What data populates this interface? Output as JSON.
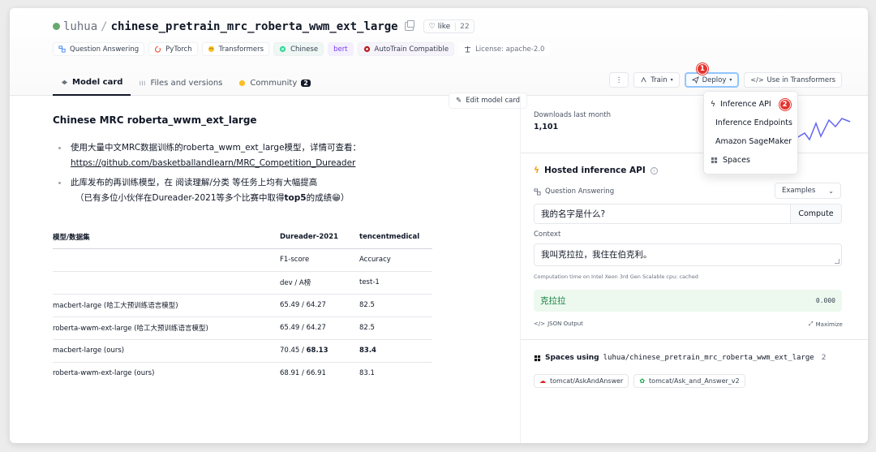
{
  "repo": {
    "owner": "luhua",
    "separator": "/",
    "name": "chinese_pretrain_mrc_roberta_wwm_ext_large",
    "like_label": "like",
    "like_count": "22"
  },
  "tags": [
    {
      "label": "Question Answering",
      "icon": "qa-icon"
    },
    {
      "label": "PyTorch",
      "icon": "pytorch-icon"
    },
    {
      "label": "Transformers",
      "icon": "hf-icon"
    },
    {
      "label": "Chinese",
      "icon": "globe-icon"
    },
    {
      "label": "bert",
      "icon": ""
    },
    {
      "label": "AutoTrain Compatible",
      "icon": "autotrain-icon"
    },
    {
      "label": "License: apache-2.0",
      "icon": "scale-icon"
    }
  ],
  "tabs": {
    "model_card": "Model card",
    "files": "Files and versions",
    "community": "Community",
    "community_count": "2"
  },
  "actions": {
    "more": "⋮",
    "train": "Train",
    "deploy": "Deploy",
    "use_in": "Use in Transformers"
  },
  "callouts": {
    "one": "1",
    "two": "2"
  },
  "deploy_menu": [
    {
      "label": "Inference API",
      "icon": "bolt-icon"
    },
    {
      "label": "Inference Endpoints",
      "icon": "endpoints-icon"
    },
    {
      "label": "Amazon SageMaker",
      "icon": "sagemaker-icon"
    },
    {
      "label": "Spaces",
      "icon": "spaces-icon"
    }
  ],
  "edit_card": "Edit model card",
  "model_card": {
    "heading": "Chinese MRC roberta_wwm_ext_large",
    "bullet1_line1": "使用大量中文MRC数据训练的roberta_wwm_ext_large模型，详情可查看：",
    "bullet1_link": "https://github.com/basketballandlearn/MRC_Competition_Dureader",
    "bullet2_line1": "此库发布的再训练模型，在 阅读理解/分类 等任务上均有大幅提高",
    "bullet2_line2_pre": "（已有多位小伙伴在Dureader-2021等多个比赛中取得",
    "bullet2_line2_bold": "top5",
    "bullet2_line2_post": "的成绩😁）"
  },
  "table": {
    "headers": [
      "模型/数据集",
      "Dureader-2021",
      "tencentmedical"
    ],
    "rows": [
      [
        "",
        "F1-score",
        "Accuracy"
      ],
      [
        "",
        "dev / A榜",
        "test-1"
      ],
      [
        "macbert-large (哈工大预训练语言模型)",
        "65.49 / 64.27",
        "82.5"
      ],
      [
        "roberta-wwm-ext-large (哈工大预训练语言模型)",
        "65.49 / 64.27",
        "82.5"
      ],
      [
        "macbert-large (ours)",
        "70.45 / ",
        "83.4"
      ],
      [
        "roberta-wwm-ext-large (ours)",
        "68.91 / 66.91",
        "83.1"
      ]
    ],
    "bold_tail_row5": "68.13"
  },
  "downloads": {
    "label": "Downloads last month",
    "value": "1,101"
  },
  "inference": {
    "title": "Hosted inference API",
    "task": "Question Answering",
    "examples": "Examples",
    "question": "我的名字是什么?",
    "compute": "Compute",
    "context_label": "Context",
    "context": "我叫克拉拉，我住在伯克利。",
    "comp_time": "Computation time on Intel Xeon 3rd Gen Scalable cpu: cached",
    "answer": "克拉拉",
    "score": "0.000",
    "json_output": "JSON Output",
    "maximize": "Maximize"
  },
  "spaces": {
    "title_bold": "Spaces using",
    "repo": "luhua/chinese_pretrain_mrc_roberta_wwm_ext_large",
    "count": "2",
    "items": [
      "tomcat/AskAndAnswer",
      "tomcat/Ask_and_Answer_v2"
    ]
  },
  "colors": {
    "accent_blue": "#93c5fd",
    "callout_red": "#e5322d",
    "answer_bg": "#edf9ef"
  }
}
